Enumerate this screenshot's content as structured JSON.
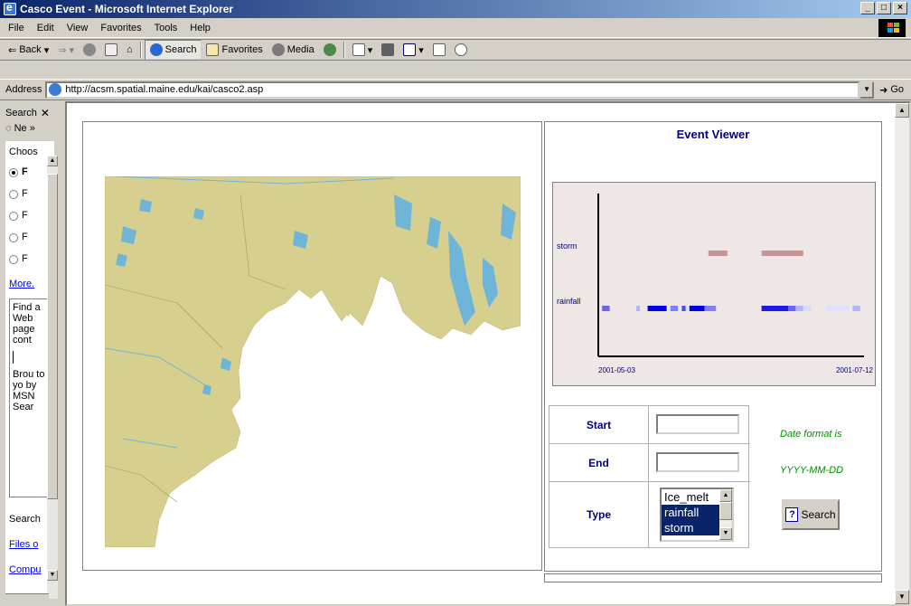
{
  "window": {
    "title": "Casco Event - Microsoft Internet Explorer",
    "controls": [
      "_",
      "□",
      "×"
    ]
  },
  "menu": [
    "File",
    "Edit",
    "View",
    "Favorites",
    "Tools",
    "Help"
  ],
  "toolbar": {
    "back": "Back",
    "search": "Search",
    "favorites": "Favorites",
    "media": "Media"
  },
  "address": {
    "label": "Address",
    "url": "http://acsm.spatial.maine.edu/kai/casco2.asp",
    "go": "Go"
  },
  "search_pane": {
    "title": "Search",
    "new": "Ne",
    "choose": "Choos",
    "radio_labels": [
      "F",
      "F",
      "F",
      "F",
      "F"
    ],
    "more": "More.",
    "box_text": "Find a Web page cont",
    "box_text2": "Brou to yo by MSN Sear",
    "search_label": "Search",
    "link1": "Files o",
    "link2": "Compu"
  },
  "viewer": {
    "title": "Event Viewer",
    "start_label": "Start",
    "end_label": "End",
    "type_label": "Type",
    "start_value": "",
    "end_value": "",
    "type_options": [
      "Ice_melt",
      "rainfall",
      "storm"
    ],
    "type_selected": [
      "rainfall",
      "storm"
    ],
    "date_note_1": "Date format is",
    "date_note_2": "YYYY-MM-DD",
    "search_button": "Search"
  },
  "chart_data": {
    "type": "timeline",
    "title": "",
    "x_start": "2001-05-03",
    "x_end": "2001-07-12",
    "categories": [
      "storm",
      "rainfall"
    ],
    "colors": {
      "storm": "#c89595",
      "rainfall": "#0000e8",
      "background": "#efe6e6"
    },
    "series": [
      {
        "name": "storm",
        "intervals": [
          {
            "start": "2001-06-01",
            "end": "2001-06-06"
          },
          {
            "start": "2001-06-15",
            "end": "2001-06-26"
          }
        ]
      },
      {
        "name": "rainfall",
        "intervals": [
          {
            "start": "2001-05-04",
            "end": "2001-05-06",
            "intensity": 0.6
          },
          {
            "start": "2001-05-13",
            "end": "2001-05-14",
            "intensity": 0.3
          },
          {
            "start": "2001-05-16",
            "end": "2001-05-21",
            "intensity": 1.0
          },
          {
            "start": "2001-05-22",
            "end": "2001-05-24",
            "intensity": 0.5
          },
          {
            "start": "2001-05-25",
            "end": "2001-05-26",
            "intensity": 0.7
          },
          {
            "start": "2001-05-27",
            "end": "2001-05-31",
            "intensity": 1.0
          },
          {
            "start": "2001-05-31",
            "end": "2001-06-03",
            "intensity": 0.5
          },
          {
            "start": "2001-06-15",
            "end": "2001-06-22",
            "intensity": 0.9
          },
          {
            "start": "2001-06-22",
            "end": "2001-06-24",
            "intensity": 0.6
          },
          {
            "start": "2001-06-24",
            "end": "2001-06-26",
            "intensity": 0.3
          },
          {
            "start": "2001-06-26",
            "end": "2001-06-28",
            "intensity": 0.15
          },
          {
            "start": "2001-07-02",
            "end": "2001-07-08",
            "intensity": 0.12
          },
          {
            "start": "2001-07-09",
            "end": "2001-07-11",
            "intensity": 0.3
          }
        ]
      }
    ]
  }
}
